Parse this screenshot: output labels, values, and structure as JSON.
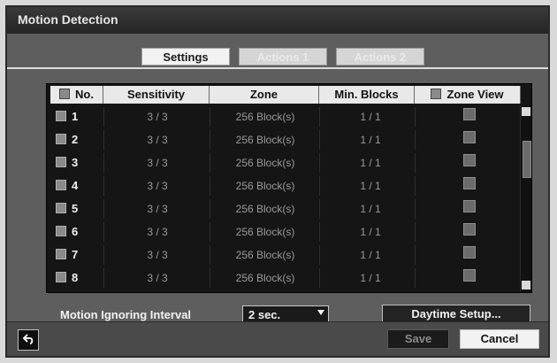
{
  "window": {
    "title": "Motion Detection"
  },
  "tabs": [
    {
      "label": "Settings",
      "active": true
    },
    {
      "label": "Actions 1",
      "active": false
    },
    {
      "label": "Actions 2",
      "active": false
    }
  ],
  "table": {
    "columns": [
      "No.",
      "Sensitivity",
      "Zone",
      "Min. Blocks",
      "Zone View"
    ],
    "rows": [
      {
        "no": "1",
        "sensitivity": "3 / 3",
        "zone": "256 Block(s)",
        "min_blocks": "1 / 1"
      },
      {
        "no": "2",
        "sensitivity": "3 / 3",
        "zone": "256 Block(s)",
        "min_blocks": "1 / 1"
      },
      {
        "no": "3",
        "sensitivity": "3 / 3",
        "zone": "256 Block(s)",
        "min_blocks": "1 / 1"
      },
      {
        "no": "4",
        "sensitivity": "3 / 3",
        "zone": "256 Block(s)",
        "min_blocks": "1 / 1"
      },
      {
        "no": "5",
        "sensitivity": "3 / 3",
        "zone": "256 Block(s)",
        "min_blocks": "1 / 1"
      },
      {
        "no": "6",
        "sensitivity": "3 / 3",
        "zone": "256 Block(s)",
        "min_blocks": "1 / 1"
      },
      {
        "no": "7",
        "sensitivity": "3 / 3",
        "zone": "256 Block(s)",
        "min_blocks": "1 / 1"
      },
      {
        "no": "8",
        "sensitivity": "3 / 3",
        "zone": "256 Block(s)",
        "min_blocks": "1 / 1"
      }
    ]
  },
  "controls": {
    "interval_label": "Motion Ignoring Interval",
    "interval_value": "2 sec.",
    "daytime_setup_label": "Daytime Setup...",
    "save_label": "Save",
    "cancel_label": "Cancel"
  },
  "icons": {
    "back": "back-arrow-icon"
  },
  "colors": {
    "background": "#5e5e5e",
    "header": "#e9e9e9",
    "table": "#151515"
  }
}
